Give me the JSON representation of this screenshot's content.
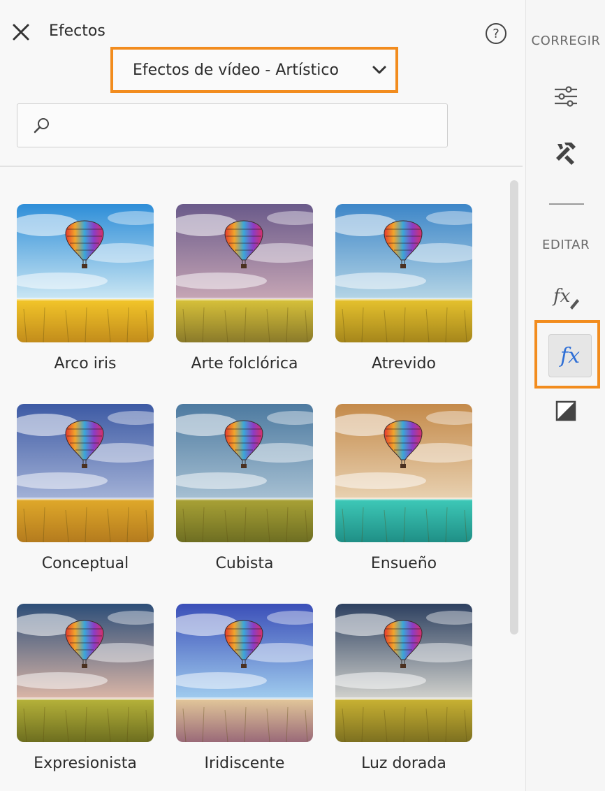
{
  "header": {
    "title": "Efectos",
    "close_icon": "close-icon",
    "help_icon": "help-icon"
  },
  "category_dropdown": {
    "selected": "Efectos de vídeo - Artístico",
    "highlight_color": "#f28c1e"
  },
  "search": {
    "value": "",
    "placeholder": ""
  },
  "effects": [
    {
      "label": "Arco iris",
      "sky_top": "#2e8ed8",
      "sky_bottom": "#cfe9f4",
      "field_top": "#f3c62a",
      "field_bottom": "#c28c1b",
      "tint": "none"
    },
    {
      "label": "Arte folclórica",
      "sky_top": "#6a5a8a",
      "sky_bottom": "#c9a8b6",
      "field_top": "#d8c23a",
      "field_bottom": "#8a7a2a",
      "tint": "warm"
    },
    {
      "label": "Atrevido",
      "sky_top": "#3d86c8",
      "sky_bottom": "#b8d7e6",
      "field_top": "#e6c22e",
      "field_bottom": "#a5861b",
      "tint": "none"
    },
    {
      "label": "Conceptual",
      "sky_top": "#3d5aa4",
      "sky_bottom": "#a6b4d8",
      "field_top": "#e0a92a",
      "field_bottom": "#b47b1e",
      "tint": "cool"
    },
    {
      "label": "Cubista",
      "sky_top": "#4d7aa0",
      "sky_bottom": "#a9c2d4",
      "field_top": "#a9a236",
      "field_bottom": "#6e6e22",
      "tint": "none"
    },
    {
      "label": "Ensueño",
      "sky_top": "#c48a4a",
      "sky_bottom": "#e9d3b4",
      "field_top": "#3ec9b8",
      "field_bottom": "#1f8f86",
      "tint": "dream"
    },
    {
      "label": "Expresionista",
      "sky_top": "#2d4e78",
      "sky_bottom": "#e0b9a8",
      "field_top": "#b6b23a",
      "field_bottom": "#6d6e1f",
      "tint": "none"
    },
    {
      "label": "Iridiscente",
      "sky_top": "#3b4fb8",
      "sky_bottom": "#a3d0f0",
      "field_top": "#e2c79a",
      "field_bottom": "#9a6a78",
      "tint": "none"
    },
    {
      "label": "Luz dorada",
      "sky_top": "#2d4060",
      "sky_bottom": "#d6d6d0",
      "field_top": "#c9b233",
      "field_bottom": "#7d7020",
      "tint": "none"
    }
  ],
  "sidebar": {
    "section_corregir": "CORREGIR",
    "section_editar": "EDITAR",
    "icons": {
      "adjust": "sliders-icon",
      "tools": "hammer-wrench-icon",
      "fx_edit": "fx-edit-icon",
      "fx": "fx-icon",
      "contrast": "contrast-icon"
    },
    "fx_label": "fx",
    "active_color": "#2f6fd6"
  }
}
